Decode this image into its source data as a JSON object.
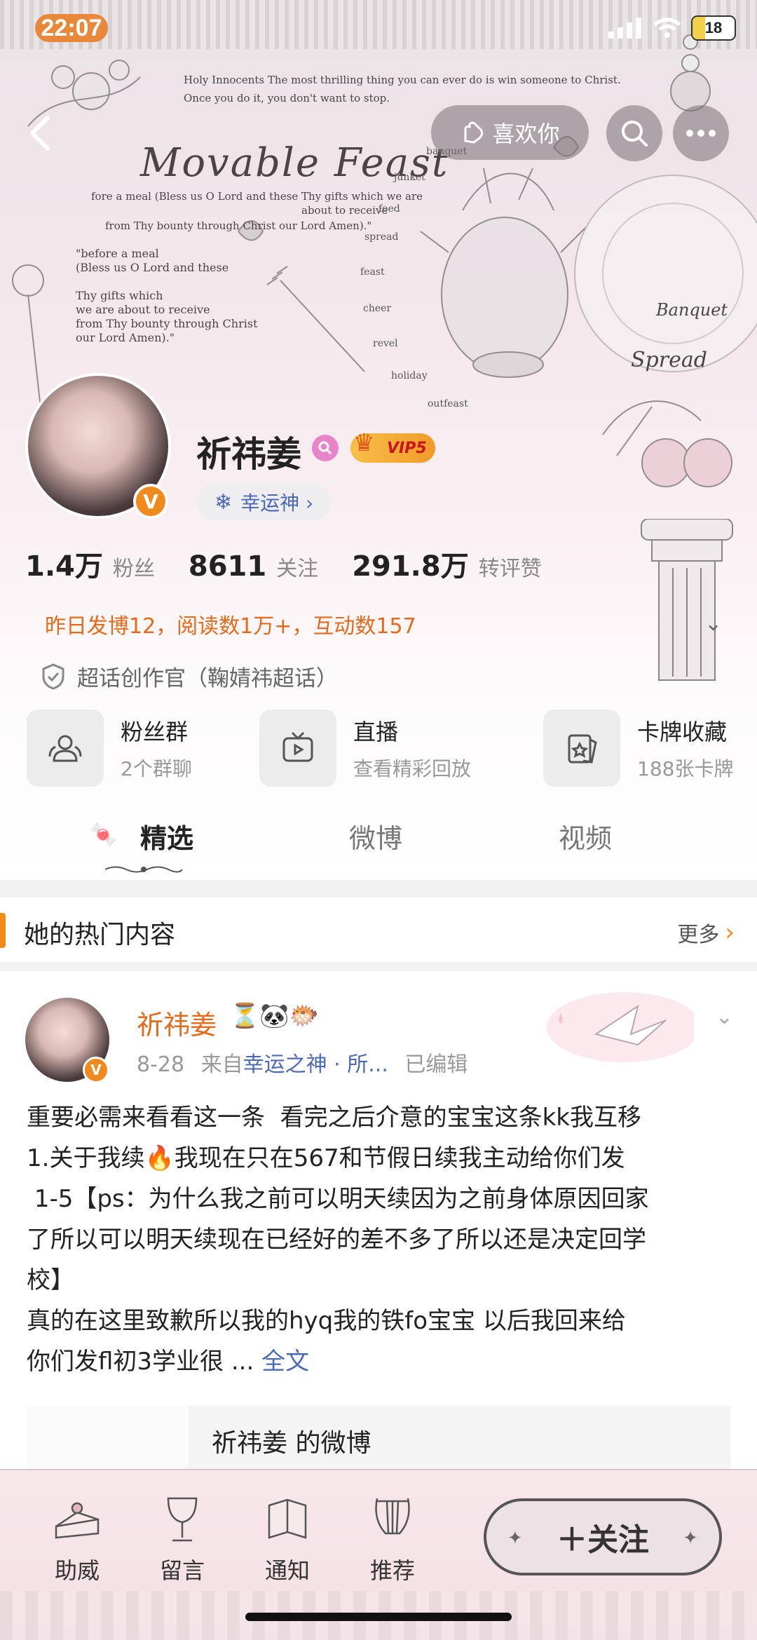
{
  "status_bar": {
    "time": "22:07",
    "battery": "18"
  },
  "cover": {
    "title": "Movable Feast",
    "line1": "Holy Innocents The most thrilling thing you can ever do is win someone to Christ.",
    "line2": "Once you do it, you don't want to stop.",
    "grace_short": "fore a meal (Bless us O Lord and these Thy gifts which we are",
    "grace_short2": "about to receive",
    "grace_short3": "from Thy bounty through Christ our Lord Amen).\"",
    "grace_long": "\"before a meal\n(Bless us O Lord and these\n\nThy gifts which\nwe are about to receive\nfrom Thy bounty through Christ\nour Lord Amen).\"",
    "words": [
      "banquet",
      "junket",
      "feed",
      "spread",
      "feast",
      "cheer",
      "revel",
      "holiday",
      "outfeast"
    ],
    "banquet": "Banquet",
    "spread": "Spread"
  },
  "nav": {
    "like_label": "喜欢你"
  },
  "profile": {
    "name": "祈祎姜",
    "vip": "VIP5",
    "v_badge": "V",
    "lucky_label": "幸运神 ›",
    "stats": [
      {
        "num": "1.4万",
        "label": "粉丝"
      },
      {
        "num": "8611",
        "label": "关注"
      },
      {
        "num": "291.8万",
        "label": "转评赞"
      }
    ],
    "yesterday": "昨日发博12，阅读数1万+，互动数157",
    "super_topic": "超话创作官（鞠婧祎超话）"
  },
  "quick": [
    {
      "title": "粉丝群",
      "sub": "2个群聊"
    },
    {
      "title": "直播",
      "sub": "查看精彩回放"
    },
    {
      "title": "卡牌收藏",
      "sub": "188张卡牌"
    }
  ],
  "tabs": [
    "精选",
    "微博",
    "视频"
  ],
  "hot": {
    "title": "她的热门内容",
    "more": "更多"
  },
  "post": {
    "name": "祈祎姜",
    "emojis": "⏳🐼🐡",
    "date": "8-28",
    "from": "来自",
    "source": "幸运之神 · 所...",
    "edited": "已编辑",
    "body": "重要必需来看看这一条  看完之后介意的宝宝这条kk我互移\n1.关于我续🔥我现在只在567和节假日续我主动给你们发\n 1-5【ps：为什么我之前可以明天续因为之前身体原因回家\n了所以可以明天续现在已经好的差不多了所以还是决定回学\n校】\n真的在这里致歉所以我的hyq我的铁fo宝宝 以后我回来给\n你们发fl初3学业很 ... ",
    "full": "全文",
    "repost_title": "祈祎姜 的微博"
  },
  "bottom": {
    "items": [
      "助威",
      "留言",
      "通知",
      "推荐"
    ],
    "follow": "＋关注"
  },
  "colors": {
    "accent": "#f08a1c",
    "link": "#4b69b5",
    "name_orange": "#e46a1c"
  }
}
